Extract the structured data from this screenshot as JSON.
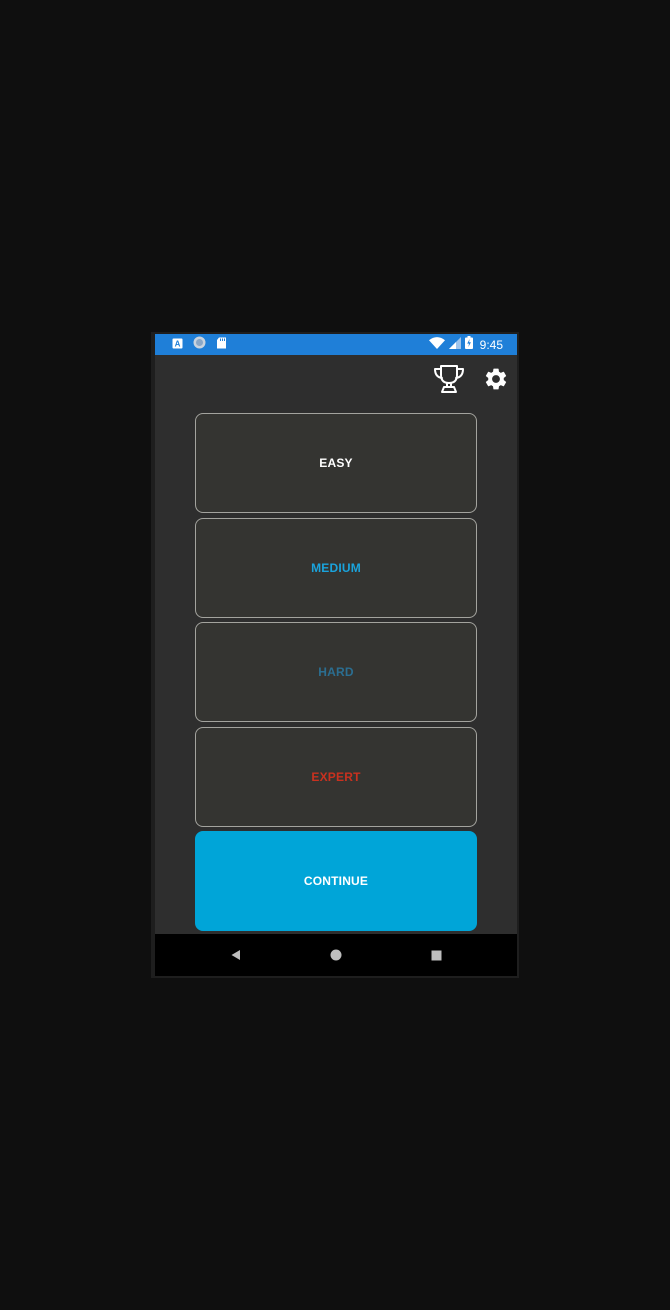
{
  "status_bar": {
    "time": "9:45",
    "color": "#1f7fd8",
    "left_icons": [
      "a-notification-icon",
      "circle-notification-icon",
      "sd-card-icon"
    ],
    "right_icons": [
      "wifi-icon",
      "cell-signal-icon",
      "battery-charging-icon"
    ]
  },
  "toolbar": {
    "icons": [
      "trophy-icon",
      "gear-icon"
    ]
  },
  "options": [
    {
      "label": "EASY",
      "color": "#ffffff"
    },
    {
      "label": "MEDIUM",
      "color": "#1aa3dc"
    },
    {
      "label": "HARD",
      "color": "#2b6e91"
    },
    {
      "label": "EXPERT",
      "color": "#c9311f"
    }
  ],
  "continue": {
    "label": "CONTINUE",
    "color": "#00a5d8"
  },
  "nav_bar": {
    "icons": [
      "back-icon",
      "home-icon",
      "recents-icon"
    ]
  }
}
